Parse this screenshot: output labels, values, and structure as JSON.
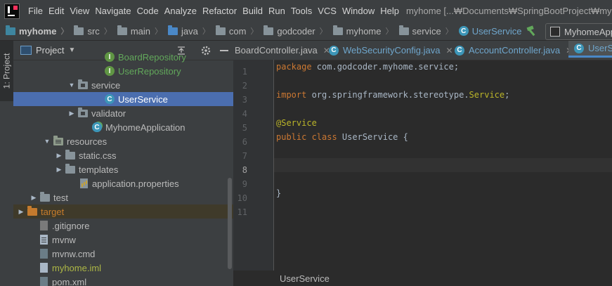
{
  "menubar": {
    "items": [
      "File",
      "Edit",
      "View",
      "Navigate",
      "Code",
      "Analyze",
      "Refactor",
      "Build",
      "Run",
      "Tools",
      "VCS",
      "Window",
      "Help"
    ],
    "window_title": "myhome [...₩Documents₩SpringBootProject₩myho"
  },
  "navbar": {
    "crumbs": [
      "myhome",
      "src",
      "main",
      "java",
      "com",
      "godcoder",
      "myhome",
      "service"
    ],
    "current_class": "UserService",
    "run_config": "MyhomeApp"
  },
  "side_tab": "1: Project",
  "project_panel": {
    "title": "Project",
    "rows": [
      {
        "label": "BoardRepository",
        "kind": "interface",
        "indent": 130,
        "arrow": "",
        "color": "green"
      },
      {
        "label": "UserRepository",
        "kind": "interface",
        "indent": 130,
        "arrow": "",
        "color": "green"
      },
      {
        "label": "service",
        "kind": "package",
        "indent": 92,
        "arrow": "▼",
        "color": ""
      },
      {
        "label": "UserService",
        "kind": "class",
        "indent": 130,
        "arrow": "",
        "color": "white",
        "selected": true
      },
      {
        "label": "validator",
        "kind": "package",
        "indent": 92,
        "arrow": "▶",
        "color": ""
      },
      {
        "label": "MyhomeApplication",
        "kind": "spring",
        "indent": 112,
        "arrow": "",
        "color": ""
      },
      {
        "label": "resources",
        "kind": "res",
        "indent": 57,
        "arrow": "▼",
        "color": ""
      },
      {
        "label": "static.css",
        "kind": "folder",
        "indent": 74,
        "arrow": "▶",
        "color": ""
      },
      {
        "label": "templates",
        "kind": "folder",
        "indent": 74,
        "arrow": "▶",
        "color": ""
      },
      {
        "label": "application.properties",
        "kind": "props",
        "indent": 95,
        "arrow": "",
        "color": ""
      },
      {
        "label": "test",
        "kind": "folder",
        "indent": 38,
        "arrow": "▶",
        "color": ""
      },
      {
        "label": "target",
        "kind": "orange",
        "indent": 20,
        "arrow": "▶",
        "color": "orange",
        "excluded": true
      },
      {
        "label": ".gitignore",
        "kind": "git",
        "indent": 38,
        "arrow": "",
        "color": ""
      },
      {
        "label": "mvnw",
        "kind": "text",
        "indent": 38,
        "arrow": "",
        "color": ""
      },
      {
        "label": "mvnw.cmd",
        "kind": "cmd",
        "indent": 38,
        "arrow": "",
        "color": ""
      },
      {
        "label": "myhome.iml",
        "kind": "iml",
        "indent": 38,
        "arrow": "",
        "color": "olive"
      },
      {
        "label": "pom.xml",
        "kind": "cmd",
        "indent": 38,
        "arrow": "",
        "color": ""
      }
    ]
  },
  "editor": {
    "tabs": [
      {
        "label": "BoardController.java",
        "active": false,
        "icon": false
      },
      {
        "label": "WebSecurityConfig.java",
        "active": false,
        "icon": true
      },
      {
        "label": "AccountController.java",
        "active": false,
        "icon": true
      },
      {
        "label": "UserSe",
        "active": true,
        "icon": true
      }
    ],
    "line_numbers": [
      "1",
      "2",
      "3",
      "4",
      "5",
      "6",
      "7",
      "8",
      "9",
      "10",
      "11"
    ],
    "code": {
      "l1_kw": "package",
      "l1_rest": " com.godcoder.myhome.service;",
      "l3_kw": "import",
      "l3_rest": " org.springframework.stereotype.",
      "l3_cls": "Service",
      "l3_end": ";",
      "l5_ann": "@Service",
      "l6_kw": "public class",
      "l6_name": " UserService",
      "l6_end": " {",
      "l10": "}"
    },
    "breadcrumb_bottom": "UserService"
  }
}
